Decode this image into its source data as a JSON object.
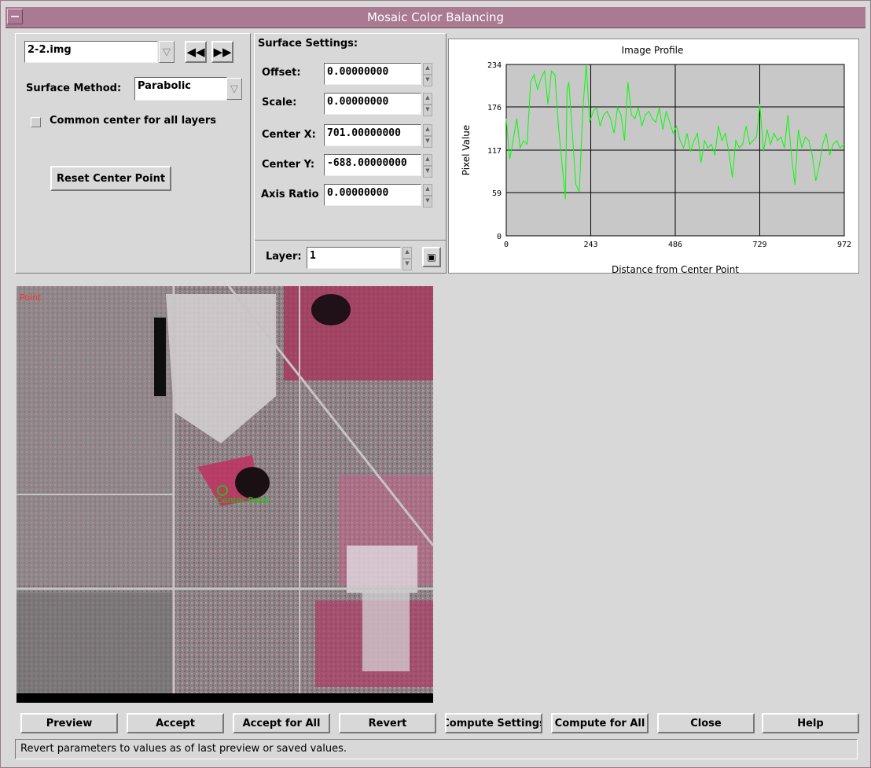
{
  "window": {
    "title": "Mosaic Color Balancing"
  },
  "file_selector": {
    "value": "2-2.img"
  },
  "surface_method": {
    "label": "Surface Method:",
    "value": "Parabolic"
  },
  "common_center": {
    "label": "Common center for all layers",
    "checked": false
  },
  "reset_button": "Reset Center Point",
  "surface_settings": {
    "title": "Surface Settings:",
    "offset": {
      "label": "Offset:",
      "value": "0.00000000"
    },
    "scale": {
      "label": "Scale:",
      "value": "0.00000000"
    },
    "center_x": {
      "label": "Center X:",
      "value": "701.00000000"
    },
    "center_y": {
      "label": "Center Y:",
      "value": "-688.00000000"
    },
    "axis_ratio": {
      "label": "Axis Ratio",
      "value": "0.00000000"
    },
    "layer": {
      "label": "Layer:",
      "value": "1"
    }
  },
  "image_overlay": {
    "point_label": "Center Point",
    "corner_label": "Point"
  },
  "buttons": {
    "preview": "Preview",
    "accept": "Accept",
    "accept_all": "Accept for All",
    "revert": "Revert",
    "compute_settings": "Compute Settings",
    "compute_all": "Compute for All",
    "close": "Close",
    "help": "Help"
  },
  "status_text": "Revert parameters to values as of last preview or saved values.",
  "colors": {
    "titlebar": "#a97a92",
    "profile_line": "#00ff00",
    "plot_bg": "#c8c8c8"
  },
  "chart_data": {
    "type": "line",
    "title": "Image Profile",
    "xlabel": "Distance from Center Point",
    "ylabel": "Pixel Value",
    "xlim": [
      0,
      972
    ],
    "ylim": [
      0,
      234
    ],
    "xticks": [
      "0",
      "243",
      "486",
      "729",
      "972"
    ],
    "yticks": [
      "0",
      "59",
      "117",
      "176",
      "234"
    ],
    "grid": true,
    "series": [
      {
        "x": [
          0,
          10,
          20,
          30,
          40,
          50,
          60,
          70,
          80,
          90,
          100,
          110,
          120,
          130,
          140,
          150,
          160,
          170,
          175,
          180,
          190,
          200,
          210,
          220,
          230,
          240,
          250,
          260,
          270,
          280,
          290,
          300,
          310,
          320,
          330,
          340,
          350,
          360,
          370,
          380,
          390,
          400,
          410,
          420,
          430,
          440,
          450,
          460,
          470,
          480,
          490,
          500,
          510,
          520,
          530,
          540,
          550,
          560,
          570,
          580,
          590,
          600,
          610,
          620,
          630,
          640,
          650,
          660,
          670,
          680,
          690,
          700,
          710,
          720,
          729,
          740,
          750,
          760,
          770,
          780,
          790,
          800,
          810,
          820,
          830,
          840,
          850,
          860,
          870,
          880,
          890,
          900,
          910,
          920,
          930,
          940,
          950,
          960,
          972
        ],
        "y": [
          160,
          105,
          130,
          160,
          120,
          130,
          125,
          210,
          220,
          200,
          215,
          225,
          180,
          225,
          220,
          150,
          100,
          50,
          200,
          210,
          140,
          70,
          60,
          170,
          234,
          155,
          170,
          175,
          150,
          165,
          170,
          160,
          140,
          175,
          165,
          130,
          210,
          165,
          160,
          175,
          150,
          165,
          170,
          160,
          155,
          175,
          145,
          170,
          155,
          140,
          150,
          130,
          120,
          140,
          115,
          130,
          140,
          100,
          130,
          120,
          125,
          110,
          150,
          130,
          140,
          115,
          80,
          130,
          120,
          125,
          150,
          125,
          130,
          135,
          180,
          115,
          145,
          125,
          140,
          130,
          135,
          120,
          165,
          110,
          70,
          145,
          120,
          135,
          130,
          110,
          75,
          95,
          125,
          140,
          110,
          125,
          130,
          120,
          125
        ]
      }
    ]
  }
}
